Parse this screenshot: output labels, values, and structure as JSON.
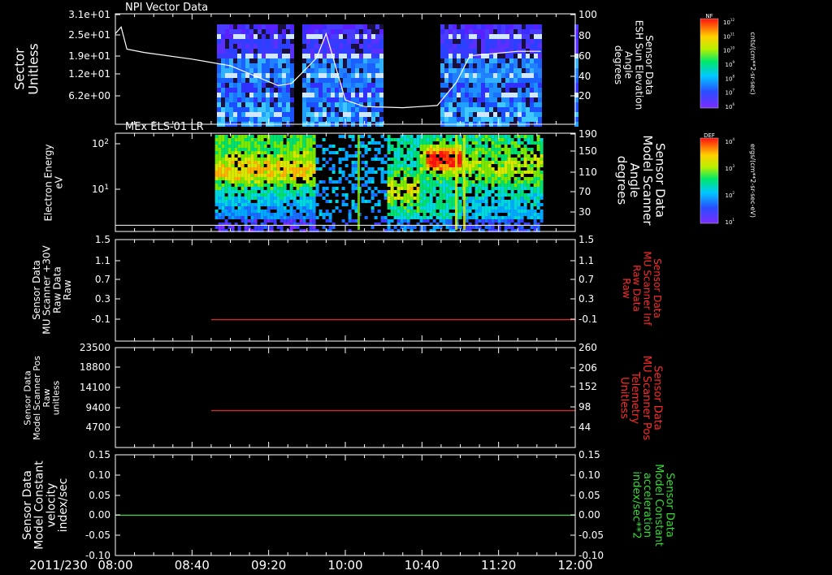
{
  "figure": {
    "date_label": "2011/230",
    "time_ticks": [
      "08:00",
      "08:40",
      "09:20",
      "10:00",
      "10:40",
      "11:20",
      "12:00"
    ],
    "colors": {
      "background": "#000000",
      "frame": "#ffffff",
      "red_trace": "#ff2a2a",
      "green_trace": "#33dd33"
    }
  },
  "chart_data": [
    {
      "type": "heatmap",
      "title": "NPI Vector Data",
      "ylabel": [
        "Sector",
        "Unitless"
      ],
      "yticks": [
        "3.1e+01",
        "2.5e+01",
        "1.9e+01",
        "1.2e+01",
        "6.2e+00"
      ],
      "right_ylabel": [
        "Sensor Data",
        "ESH Sun Elevation",
        "Angle",
        "degrees"
      ],
      "right_yticks": [
        "100",
        "80",
        "60",
        "40",
        "20"
      ],
      "right_ylim": [
        0,
        100
      ],
      "data_gaps": [
        [
          "08:00",
          "08:52"
        ],
        [
          "09:32",
          "09:37"
        ],
        [
          "10:20",
          "10:50"
        ],
        [
          "11:42",
          "12:00"
        ]
      ],
      "overlay_line": {
        "name": "ESH Sun Elevation Angle",
        "x": [
          "08:00",
          "08:03",
          "08:06",
          "08:15",
          "08:40",
          "09:00",
          "09:25",
          "09:32",
          "09:45",
          "09:50",
          "10:00",
          "10:10",
          "10:30",
          "10:48",
          "10:58",
          "11:05",
          "11:30",
          "11:42"
        ],
        "y": [
          82,
          88,
          68,
          65,
          59,
          53,
          35,
          37,
          60,
          82,
          22,
          16,
          15,
          17,
          38,
          62,
          66,
          66
        ]
      },
      "colorbar": {
        "label": "NF",
        "units": "cnts/(cm**2-sr-sec)",
        "ticks": [
          "10^12",
          "10^11",
          "10^10",
          "10^9",
          "10^8",
          "10^7",
          "10^6"
        ]
      }
    },
    {
      "type": "heatmap",
      "title": "MEx ELS-01 LR",
      "ylabel": [
        "Electron Energy",
        "eV"
      ],
      "yticks": [
        "10^2",
        "10^1"
      ],
      "right_ylabel": [
        "Sensor Data",
        "Model Scanner",
        "Angle",
        "degrees"
      ],
      "right_yticks": [
        "190",
        "150",
        "110",
        "70",
        "30"
      ],
      "right_ylim": [
        0,
        190
      ],
      "data_extent": [
        "08:52",
        "11:42"
      ],
      "overlay_line": {
        "name": "Model Scanner Angle",
        "x": [
          "08:00",
          "12:00"
        ],
        "y": [
          12,
          12
        ]
      },
      "colorbar": {
        "label": "DEF",
        "units": "ergs/(cm**2-sr-sec-eV)",
        "ticks": [
          "10^4",
          "10^3",
          "10^2",
          "10^1"
        ]
      }
    },
    {
      "type": "line",
      "ylabel": [
        "Sensor Data",
        "MU Scanner +30V",
        "Raw Data",
        "Raw"
      ],
      "yticks": [
        "1.5",
        "1.1",
        "0.7",
        "0.3",
        "-0.1"
      ],
      "ylim": [
        -0.4,
        1.5
      ],
      "right_ylabel": [
        "Sensor Data",
        "MU Scanner Inf",
        "Raw Data",
        "Raw"
      ],
      "right_yticks": [
        "1.5",
        "1.1",
        "0.7",
        "0.3",
        "-0.1"
      ],
      "series": [
        {
          "x": [
            "08:50",
            "12:00"
          ],
          "y": [
            0.0,
            0.0
          ]
        }
      ]
    },
    {
      "type": "line",
      "ylabel": [
        "Sensor Data",
        "Model Scanner Pos",
        "Raw",
        "unitless"
      ],
      "yticks": [
        "23500",
        "18800",
        "14100",
        "9400",
        "4700"
      ],
      "ylim": [
        0,
        23500
      ],
      "right_ylabel": [
        "Sensor Data",
        "MU Scanner Pos",
        "Telemetry",
        "Unitless"
      ],
      "right_yticks": [
        "260",
        "206",
        "152",
        "98",
        "44"
      ],
      "series": [
        {
          "x": [
            "08:50",
            "12:00"
          ],
          "y": [
            8650,
            8650
          ]
        }
      ]
    },
    {
      "type": "line",
      "ylabel": [
        "Sensor Data",
        "Model Constant",
        "velocity",
        "index/sec"
      ],
      "yticks": [
        "0.15",
        "0.10",
        "0.05",
        "0.00",
        "-0.05",
        "-0.10"
      ],
      "ylim": [
        -0.1,
        0.15
      ],
      "right_ylabel": [
        "Sensor Data",
        "Model Constant",
        "acceleration",
        "index/sec**2"
      ],
      "right_yticks": [
        "0.15",
        "0.10",
        "0.05",
        "0.00",
        "-0.05",
        "-0.10"
      ],
      "series": [
        {
          "x": [
            "08:00",
            "12:00"
          ],
          "y": [
            0.0,
            0.0
          ]
        }
      ]
    }
  ]
}
